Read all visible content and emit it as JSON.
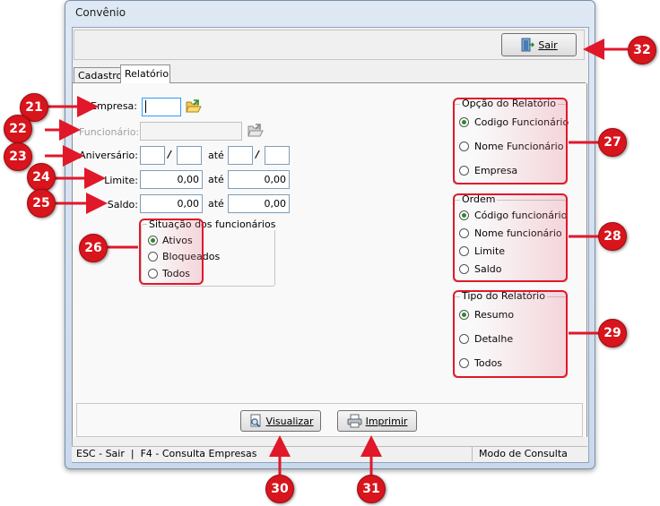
{
  "window": {
    "title": "Convênio"
  },
  "toolbar": {
    "sair_label": "Sair"
  },
  "tabs": [
    {
      "label": "Cadastro"
    },
    {
      "label": "Relatório"
    }
  ],
  "form": {
    "empresa_label": "Empresa:",
    "empresa_value": "",
    "funcionario_label": "Funcionário:",
    "funcionario_value": "",
    "aniversario_label": "Aniversário:",
    "slash": "/",
    "ate": "até",
    "limite_label": "Limite:",
    "limite_from": "0,00",
    "limite_to": "0,00",
    "saldo_label": "Saldo:",
    "saldo_from": "0,00",
    "saldo_to": "0,00"
  },
  "situacao": {
    "title": "Situação dos funcionários",
    "options": [
      "Ativos",
      "Bloqueados",
      "Todos"
    ],
    "selected": "Ativos"
  },
  "opcao_relatorio": {
    "title": "Opção do Relatório",
    "options": [
      "Codigo Funcionário",
      "Nome Funcionário",
      "Empresa"
    ],
    "selected": "Codigo Funcionário"
  },
  "ordem": {
    "title": "Ordem",
    "options": [
      "Código funcionário",
      "Nome funcionário",
      "Limite",
      "Saldo"
    ],
    "selected": "Código funcionário"
  },
  "tipo_relatorio": {
    "title": "Tipo do Relatório",
    "options": [
      "Resumo",
      "Detalhe",
      "Todos"
    ],
    "selected": "Resumo"
  },
  "actions": {
    "visualizar_label": "Visualizar",
    "imprimir_label": "Imprimir"
  },
  "statusbar": {
    "left": "ESC - Sair  |  F4 - Consulta Empresas",
    "right": "Modo de Consulta"
  },
  "callouts": [
    "21",
    "22",
    "23",
    "24",
    "25",
    "26",
    "27",
    "28",
    "29",
    "30",
    "31",
    "32"
  ],
  "colors": {
    "callout": "#d8141c",
    "arrow": "#e0182a",
    "radio_selected": "#2a8a2a"
  }
}
